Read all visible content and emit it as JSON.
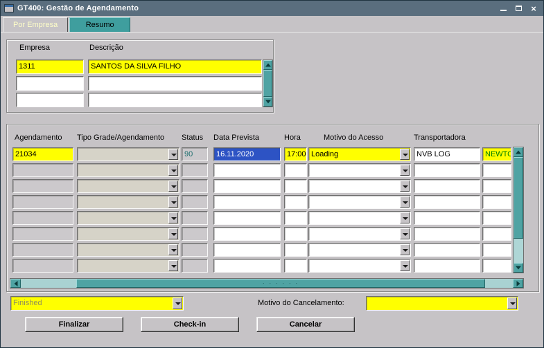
{
  "window": {
    "title": "GT400: Gestão de Agendamento",
    "close_glyph": "×"
  },
  "tabs": [
    {
      "label": "Por Empresa",
      "active": true
    },
    {
      "label": "Resumo",
      "active": false
    }
  ],
  "empresa": {
    "col1_label": "Empresa",
    "col2_label": "Descrição",
    "rows": [
      {
        "empresa": "1311",
        "descricao": "SANTOS DA SILVA FILHO",
        "highlight": true
      },
      {
        "empresa": "",
        "descricao": "",
        "highlight": false
      },
      {
        "empresa": "",
        "descricao": "",
        "highlight": false
      }
    ]
  },
  "grid": {
    "headers": [
      "Agendamento",
      "Tipo Grade/Agendamento",
      "Status",
      "Data Prevista",
      "Hora",
      "Motivo do Acesso",
      "Transportadora"
    ],
    "rows": [
      {
        "agendamento": "21034",
        "tipo_grade": "",
        "status": "90",
        "data_prevista": "16.11.2020",
        "hora": "17:00",
        "motivo_acesso": "Loading",
        "transportadora": "NVB LOG",
        "extra": "NEWTO",
        "filled": true
      },
      {
        "agendamento": "",
        "tipo_grade": "",
        "status": "",
        "data_prevista": "",
        "hora": "",
        "motivo_acesso": "",
        "transportadora": "",
        "extra": "",
        "filled": false
      },
      {
        "agendamento": "",
        "tipo_grade": "",
        "status": "",
        "data_prevista": "",
        "hora": "",
        "motivo_acesso": "",
        "transportadora": "",
        "extra": "",
        "filled": false
      },
      {
        "agendamento": "",
        "tipo_grade": "",
        "status": "",
        "data_prevista": "",
        "hora": "",
        "motivo_acesso": "",
        "transportadora": "",
        "extra": "",
        "filled": false
      },
      {
        "agendamento": "",
        "tipo_grade": "",
        "status": "",
        "data_prevista": "",
        "hora": "",
        "motivo_acesso": "",
        "transportadora": "",
        "extra": "",
        "filled": false
      },
      {
        "agendamento": "",
        "tipo_grade": "",
        "status": "",
        "data_prevista": "",
        "hora": "",
        "motivo_acesso": "",
        "transportadora": "",
        "extra": "",
        "filled": false
      },
      {
        "agendamento": "",
        "tipo_grade": "",
        "status": "",
        "data_prevista": "",
        "hora": "",
        "motivo_acesso": "",
        "transportadora": "",
        "extra": "",
        "filled": false
      },
      {
        "agendamento": "",
        "tipo_grade": "",
        "status": "",
        "data_prevista": "",
        "hora": "",
        "motivo_acesso": "",
        "transportadora": "",
        "extra": "",
        "filled": false
      }
    ]
  },
  "footer": {
    "finished_value": "Finished",
    "motivo_cancelamento_label": "Motivo do Cancelamento:",
    "motivo_cancelamento_value": "",
    "buttons": [
      {
        "label": "Finalizar"
      },
      {
        "label": "Check-in"
      },
      {
        "label": "Cancelar"
      }
    ]
  },
  "colors": {
    "titlebar": "#5a6e7e",
    "canvas_gray": "#c6c3c6",
    "tab_teal": "#3f9e9e",
    "scrollbar_teal": "#4fa3a3",
    "highlight_yellow": "#ffff00",
    "selection_blue": "#2d53c4",
    "status_text_teal": "#1f6f6f",
    "extra_text_green": "#007f00"
  }
}
